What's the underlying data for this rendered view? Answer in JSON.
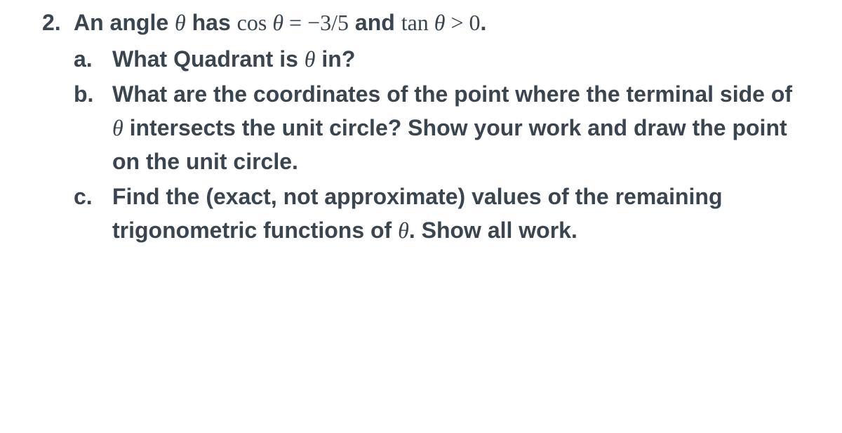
{
  "problem": {
    "number": "2.",
    "intro_part1": "An angle ",
    "intro_part2": " has ",
    "intro_part3": " and ",
    "intro_part4": ".",
    "theta": "θ",
    "cos_expr_left": "cos",
    "cos_expr_right": " = −3/5",
    "tan_expr_left": "tan",
    "tan_expr_right": " > 0",
    "parts": {
      "a": {
        "letter": "a.",
        "q1": "What Quadrant is ",
        "q2": " in?"
      },
      "b": {
        "letter": "b.",
        "q1": "What are the coordinates of the point where the terminal side of ",
        "q2": " intersects the unit circle? Show your work and draw the point on the unit circle."
      },
      "c": {
        "letter": "c.",
        "q1": "Find the (exact, not approximate) values of the remaining trigonometric functions of ",
        "q2": ". Show all work."
      }
    }
  }
}
